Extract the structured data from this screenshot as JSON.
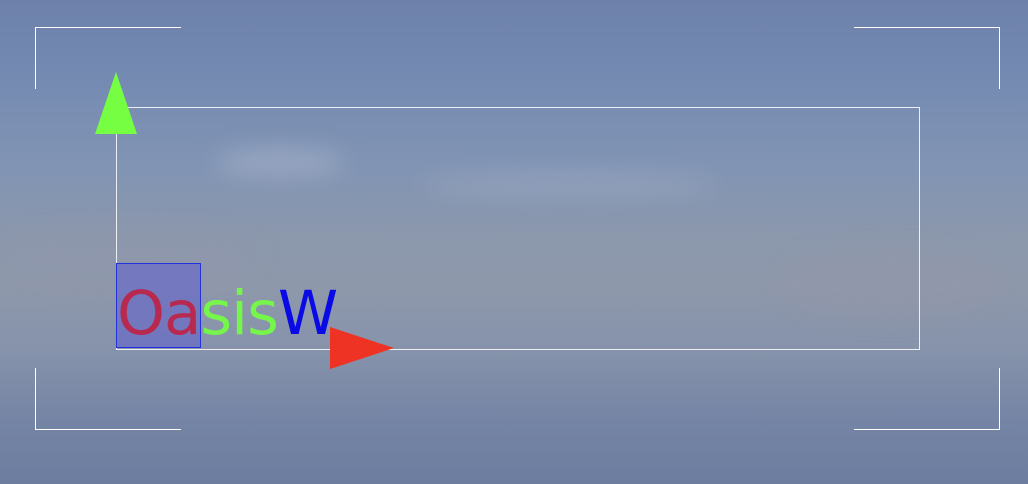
{
  "viewport": {
    "background_top": "#6d81ab",
    "background_mid": "#8c98ac",
    "background_bottom": "#6c7d9f"
  },
  "frame": {
    "color": "#ffffff"
  },
  "text_object": {
    "segments": [
      {
        "text": "Oa",
        "color": "#b8294f"
      },
      {
        "text": "sis",
        "color": "#76f54a"
      },
      {
        "text": "W",
        "color": "#0a0ae6"
      }
    ],
    "selection_color": "#5f5fcd",
    "selection_border": "#2233dd"
  },
  "gizmo": {
    "y_axis": {
      "icon": "green-up-arrow",
      "color": "#76ff42"
    },
    "x_axis": {
      "icon": "red-right-arrow",
      "color": "#ee3324"
    }
  }
}
